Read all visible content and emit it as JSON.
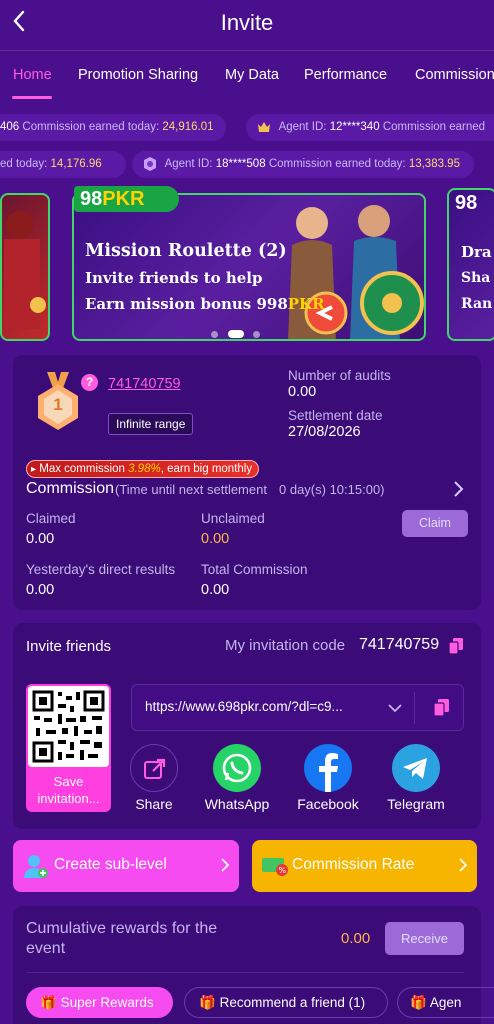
{
  "header": {
    "title": "Invite"
  },
  "tabs": [
    "Home",
    "Promotion Sharing",
    "My Data",
    "Performance",
    "Commission"
  ],
  "ticker1": {
    "a_val": "406",
    "a_label": "Commission earned today:",
    "a_amount": "24,916.01",
    "b_id_label": "Agent ID:",
    "b_id": "12****340",
    "b_label": "Commission earned"
  },
  "ticker2": {
    "a_label": "ed today:",
    "a_amount": "14,176.96",
    "b_id_label": "Agent ID:",
    "b_id": "18****508",
    "b_label": "Commission earned today:",
    "b_amount": "13,383.95"
  },
  "banner": {
    "logo_a": "98",
    "logo_b": "PKR",
    "line1": "Mission Roulette (2)",
    "line2": "Invite friends to help",
    "line3_a": "Earn mission bonus 998",
    "line3_b": "PKR",
    "right_logo": "98",
    "right_l1": "Dra",
    "right_l2": "Sha",
    "right_l3": "Ran"
  },
  "agent": {
    "level": "1",
    "code": "741740759",
    "range_badge": "Infinite range",
    "audits_label": "Number of audits",
    "audits_value": "0.00",
    "settlement_label": "Settlement date",
    "settlement_value": "27/08/2026",
    "max_commission_a": "Max commission",
    "max_commission_pct": "3.98%",
    "max_commission_b": ", earn big monthly",
    "commission_title": "Commission",
    "commission_timer_label": "(Time until next settlement",
    "commission_timer": "0 day(s) 10:15:00)",
    "claimed_label": "Claimed",
    "claimed_value": "0.00",
    "unclaimed_label": "Unclaimed",
    "unclaimed_value": "0.00",
    "claim_button": "Claim",
    "yesterday_label": "Yesterday's direct results",
    "yesterday_value": "0.00",
    "total_label": "Total Commission",
    "total_value": "0.00"
  },
  "invite": {
    "title": "Invite friends",
    "code_label": "My invitation code",
    "code_value": "741740759",
    "qr_label": "Save invitation...",
    "url": "https://www.698pkr.com/?dl=c9...",
    "share_items": [
      "Share",
      "WhatsApp",
      "Facebook",
      "Telegram"
    ]
  },
  "actions": {
    "sub_level": "Create sub-level",
    "commission_rate": "Commission Rate"
  },
  "rewards": {
    "title": "Cumulative rewards for the event",
    "value": "0.00",
    "receive": "Receive",
    "chips": [
      "Super Rewards",
      "Recommend a friend (1)",
      "Agen"
    ]
  },
  "colors": {
    "bg": "#4a0f8c",
    "card": "#3b0b78",
    "accent_pink": "#ff5ce0",
    "yellow": "#ffd86b",
    "orange_value": "#ffb54a",
    "green": "#42d66a"
  }
}
